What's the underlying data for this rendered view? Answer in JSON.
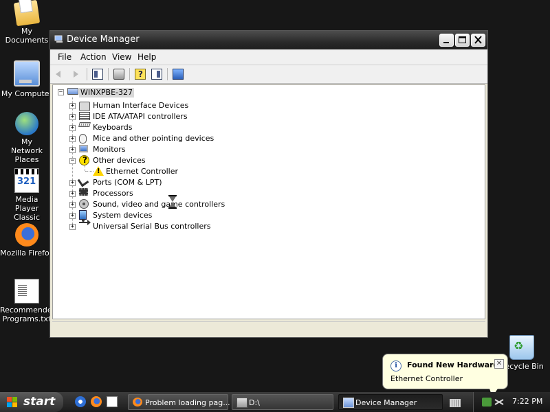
{
  "desktop": {
    "icons": [
      {
        "label": "My Documents"
      },
      {
        "label": "My Computer"
      },
      {
        "label": "My Network Places"
      },
      {
        "label": "Media Player Classic"
      },
      {
        "label": "Mozilla Firefox"
      },
      {
        "label": "Recommended Programs.txt"
      },
      {
        "label": "Recycle Bin"
      }
    ]
  },
  "window": {
    "title": "Device Manager",
    "menu": [
      "File",
      "Action",
      "View",
      "Help"
    ],
    "toolbar_icons": [
      "back-arrow-icon",
      "forward-arrow-icon",
      "console-tree-icon",
      "print-icon",
      "help-icon",
      "properties-icon",
      "scan-hardware-icon"
    ],
    "tree": {
      "root": "WINXPBE-327",
      "categories": [
        {
          "label": "Human Interface Devices",
          "icon": "hid-icon"
        },
        {
          "label": "IDE ATA/ATAPI controllers",
          "icon": "ide-controller-icon"
        },
        {
          "label": "Keyboards",
          "icon": "keyboard-icon"
        },
        {
          "label": "Mice and other pointing devices",
          "icon": "mouse-icon"
        },
        {
          "label": "Monitors",
          "icon": "monitor-icon"
        },
        {
          "label": "Other devices",
          "icon": "unknown-device-icon",
          "expanded": true,
          "children": [
            {
              "label": "Ethernet Controller",
              "icon": "warning-icon"
            }
          ]
        },
        {
          "label": "Ports (COM & LPT)",
          "icon": "port-icon"
        },
        {
          "label": "Processors",
          "icon": "processor-icon"
        },
        {
          "label": "Sound, video and game controllers",
          "icon": "sound-icon"
        },
        {
          "label": "System devices",
          "icon": "system-device-icon"
        },
        {
          "label": "Universal Serial Bus controllers",
          "icon": "usb-icon"
        }
      ]
    }
  },
  "balloon": {
    "title": "Found New Hardware",
    "text": "Ethernet Controller",
    "close_glyph": "✕"
  },
  "taskbar": {
    "start_label": "start",
    "tasks": [
      {
        "label": "Problem loading pag...",
        "active": false
      },
      {
        "label": "D:\\",
        "active": false
      },
      {
        "label": "Device Manager",
        "active": true
      }
    ],
    "clock": "7:22 PM"
  },
  "colors": {
    "desktop_bg": "#171717",
    "window_bg": "#ece9d8",
    "titlebar": "#2a2a2a",
    "balloon_bg": "#ffffe1"
  }
}
